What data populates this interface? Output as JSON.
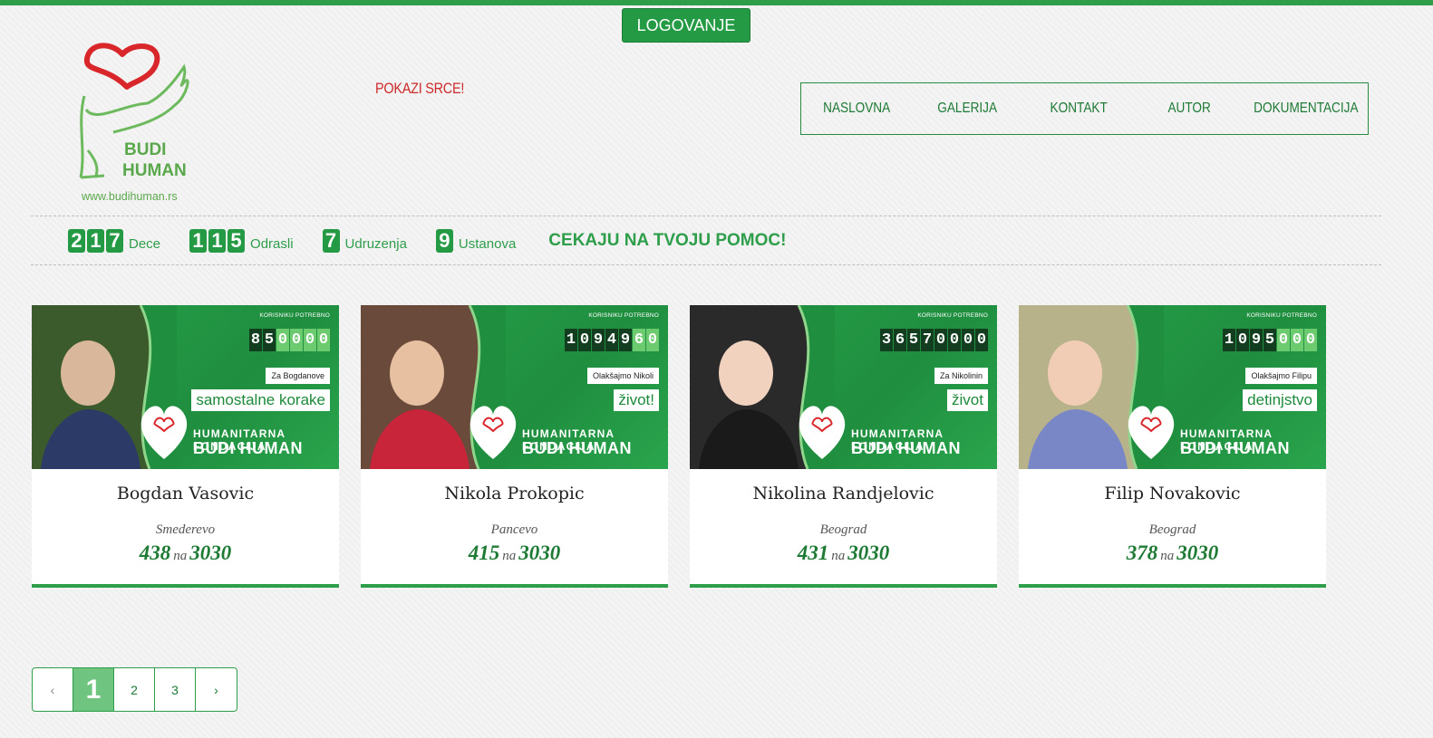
{
  "header": {
    "login_label": "LOGOVANJE",
    "logo_line1": "BUDI",
    "logo_line2": "HUMAN",
    "logo_url": "www.budihuman.rs",
    "slogan": "POKAZI SRCE!",
    "nav": [
      "NASLOVNA",
      "GALERIJA",
      "KONTAKT",
      "AUTOR",
      "DOKUMENTACIJA"
    ]
  },
  "stats": {
    "items": [
      {
        "digits": [
          "2",
          "1",
          "7"
        ],
        "label": "Dece"
      },
      {
        "digits": [
          "1",
          "1",
          "5"
        ],
        "label": "Odrasli"
      },
      {
        "digits": [
          "7"
        ],
        "label": "Udruzenja"
      },
      {
        "digits": [
          "9"
        ],
        "label": "Ustanova"
      }
    ],
    "cta": "CEKAJU NA TVOJU POMOC!"
  },
  "cards": [
    {
      "name": "Bogdan Vasovic",
      "city": "Smederevo",
      "score": "438",
      "na": "na",
      "total": "3030",
      "banner": {
        "need_label": "KORISNIKU POTREBNO",
        "digits": [
          "8",
          "5",
          "0",
          "0",
          "0",
          "0"
        ],
        "light_from": 2,
        "cap1": "Za Bogdanove",
        "cap2": "samostalne korake",
        "fond1": "HUMANITARNA FONDACIJA",
        "fond2": "BUDI HUMAN"
      }
    },
    {
      "name": "Nikola Prokopic",
      "city": "Pancevo",
      "score": "415",
      "na": "na",
      "total": "3030",
      "banner": {
        "need_label": "KORISNIKU POTREBNO",
        "digits": [
          "1",
          "0",
          "9",
          "4",
          "9",
          "6",
          "0"
        ],
        "light_from": 5,
        "cap1": "Olakšajmo Nikoli",
        "cap2": "život!",
        "fond1": "HUMANITARNA FONDACIJA",
        "fond2": "BUDI HUMAN"
      }
    },
    {
      "name": "Nikolina Randjelovic",
      "city": "Beograd",
      "score": "431",
      "na": "na",
      "total": "3030",
      "banner": {
        "need_label": "KORISNIKU POTREBNO",
        "digits": [
          "3",
          "6",
          "5",
          "7",
          "0",
          "0",
          "0",
          "0"
        ],
        "light_from": 8,
        "cap1": "Za Nikolinin",
        "cap2": "život",
        "fond1": "HUMANITARNA FONDACIJA",
        "fond2": "BUDI HUMAN"
      }
    },
    {
      "name": "Filip Novakovic",
      "city": "Beograd",
      "score": "378",
      "na": "na",
      "total": "3030",
      "banner": {
        "need_label": "KORISNIKU POTREBNO",
        "digits": [
          "1",
          "0",
          "9",
          "5",
          "0",
          "0",
          "0"
        ],
        "light_from": 4,
        "cap1": "Olakšajmo Filipu",
        "cap2": "detinjstvo",
        "fond1": "HUMANITARNA FONDACIJA",
        "fond2": "BUDI HUMAN"
      }
    }
  ],
  "pagination": {
    "prev": "‹",
    "pages": [
      "1",
      "2",
      "3"
    ],
    "active": "1",
    "next": "›"
  },
  "colors": {
    "brand_green": "#239a43",
    "accent_red": "#cc2a2a"
  }
}
